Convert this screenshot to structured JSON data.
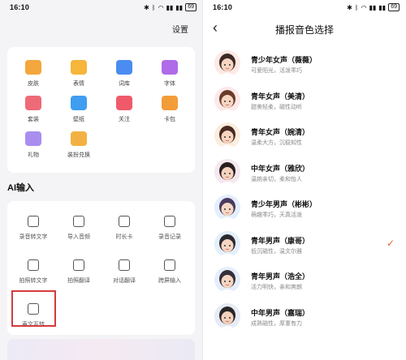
{
  "status": {
    "time": "16:10",
    "battery": "69"
  },
  "left": {
    "settings_label": "设置",
    "grid": [
      {
        "label": "皮肤",
        "icon": "skin-icon",
        "color": "#f3a73c"
      },
      {
        "label": "表情",
        "icon": "emoji-icon",
        "color": "#f6b53b"
      },
      {
        "label": "词库",
        "icon": "dictionary-icon",
        "color": "#4a8cf0"
      },
      {
        "label": "字体",
        "icon": "font-icon",
        "color": "#b06be8"
      },
      {
        "label": "套装",
        "icon": "suite-icon",
        "color": "#ef6a78"
      },
      {
        "label": "壁纸",
        "icon": "wallpaper-icon",
        "color": "#3f9ef0"
      },
      {
        "label": "关注",
        "icon": "heart-icon",
        "color": "#ef5a6a"
      },
      {
        "label": "卡包",
        "icon": "card-pack-icon",
        "color": "#f39c3a"
      },
      {
        "label": "礼物",
        "icon": "gift-icon",
        "color": "#a98ef0"
      },
      {
        "label": "装扮兑换",
        "icon": "exchange-icon",
        "color": "#f2b243"
      }
    ],
    "ai_title": "AI输入",
    "tools": [
      {
        "label": "录音转文字",
        "icon": "microphone-icon"
      },
      {
        "label": "导入音频",
        "icon": "folder-icon"
      },
      {
        "label": "时长卡",
        "icon": "clock-icon"
      },
      {
        "label": "录音记录",
        "icon": "record-list-icon"
      },
      {
        "label": "拍照转文字",
        "icon": "scan-icon"
      },
      {
        "label": "拍照翻译",
        "icon": "camera-translate-icon"
      },
      {
        "label": "对话翻译",
        "icon": "dialog-translate-icon"
      },
      {
        "label": "跨屏输入",
        "icon": "cross-screen-icon"
      },
      {
        "label": "声文互转",
        "icon": "voice-text-convert-icon"
      }
    ]
  },
  "right": {
    "title": "播报音色选择",
    "voices": [
      {
        "name": "青少年女声（薇薇）",
        "desc": "可爱阳光，活泼乖巧",
        "avatar": "girl-avatar",
        "skin": "#f7d5c0",
        "hair": "#3b2a24",
        "bg": "#ffe9e4",
        "selected": false
      },
      {
        "name": "青年女声（美清）",
        "desc": "甜美轻柔，磁性动听",
        "avatar": "young-woman-avatar",
        "skin": "#f7d5c0",
        "hair": "#6b3b2a",
        "bg": "#fde8ea",
        "selected": false
      },
      {
        "name": "青年女声（婉清）",
        "desc": "温柔大方，沉稳知性",
        "avatar": "young-woman-avatar",
        "skin": "#f7d5c0",
        "hair": "#4a2a20",
        "bg": "#fbeede",
        "selected": false
      },
      {
        "name": "中年女声（雅欣）",
        "desc": "温婉亲切，柔和怡人",
        "avatar": "middle-aged-woman-avatar",
        "skin": "#f5d3bf",
        "hair": "#2b2020",
        "bg": "#f6e8ef",
        "selected": false
      },
      {
        "name": "青少年男声（彬彬）",
        "desc": "萌趣乖巧，天真活泼",
        "avatar": "boy-avatar",
        "skin": "#f7d8c4",
        "hair": "#4a3a60",
        "bg": "#e4eefc",
        "selected": false
      },
      {
        "name": "青年男声（康哥）",
        "desc": "低沉磁性，温文尔雅",
        "avatar": "young-man-avatar",
        "skin": "#f6d6c2",
        "hair": "#2c2a30",
        "bg": "#e3f0fb",
        "selected": true
      },
      {
        "name": "青年男声（浩全）",
        "desc": "活力明快，亲和爽朗",
        "avatar": "young-man-avatar",
        "skin": "#f6d6c2",
        "hair": "#35303a",
        "bg": "#e6eefb",
        "selected": false
      },
      {
        "name": "中年男声（嘉瑞）",
        "desc": "成熟磁性，厚重有力",
        "avatar": "middle-aged-man-avatar",
        "skin": "#f3d2bd",
        "hair": "#2a2626",
        "bg": "#e6ebf5",
        "selected": false
      }
    ],
    "check_glyph": "✓"
  }
}
